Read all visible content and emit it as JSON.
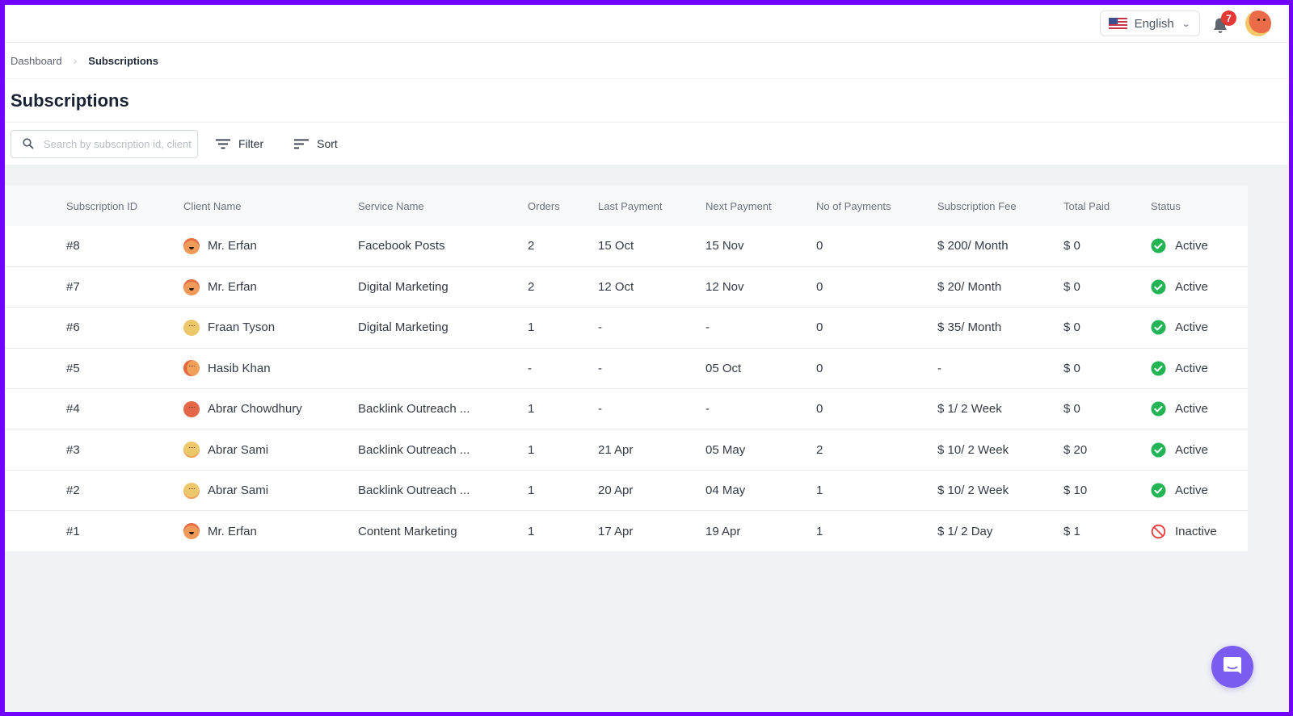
{
  "header": {
    "language": {
      "label": "English",
      "flag_icon": "us-flag-icon"
    },
    "notifications": {
      "count": "7"
    }
  },
  "breadcrumb": {
    "items": [
      {
        "label": "Dashboard"
      },
      {
        "label": "Subscriptions"
      }
    ]
  },
  "page": {
    "title": "Subscriptions"
  },
  "toolbar": {
    "search_placeholder": "Search by subscription id, client",
    "search_value": "",
    "filter_label": "Filter",
    "sort_label": "Sort"
  },
  "table": {
    "columns": [
      "Subscription ID",
      "Client Name",
      "Service Name",
      "Orders",
      "Last Payment",
      "Next Payment",
      "No of Payments",
      "Subscription Fee",
      "Total Paid",
      "Status"
    ],
    "rows": [
      {
        "id": "#8",
        "client": "Mr. Erfan",
        "avatar": "erfan",
        "service": "Facebook Posts",
        "orders": "2",
        "last_payment": "15 Oct",
        "next_payment": "15 Nov",
        "num_payments": "0",
        "fee": "$ 200/ Month",
        "total_paid": "$ 0",
        "status": "Active"
      },
      {
        "id": "#7",
        "client": "Mr. Erfan",
        "avatar": "erfan",
        "service": "Digital Marketing",
        "orders": "2",
        "last_payment": "12 Oct",
        "next_payment": "12 Nov",
        "num_payments": "0",
        "fee": "$ 20/ Month",
        "total_paid": "$ 0",
        "status": "Active"
      },
      {
        "id": "#6",
        "client": "Fraan Tyson",
        "avatar": "fraan",
        "service": "Digital Marketing",
        "orders": "1",
        "last_payment": "-",
        "next_payment": "-",
        "num_payments": "0",
        "fee": "$ 35/ Month",
        "total_paid": "$ 0",
        "status": "Active"
      },
      {
        "id": "#5",
        "client": "Hasib Khan",
        "avatar": "hasib",
        "service": "",
        "orders": "-",
        "last_payment": "-",
        "next_payment": "05 Oct",
        "num_payments": "0",
        "fee": "-",
        "total_paid": "$ 0",
        "status": "Active"
      },
      {
        "id": "#4",
        "client": "Abrar Chowdhury",
        "avatar": "abrarc",
        "service": "Backlink Outreach ...",
        "orders": "1",
        "last_payment": "-",
        "next_payment": "-",
        "num_payments": "0",
        "fee": "$ 1/ 2 Week",
        "total_paid": "$ 0",
        "status": "Active"
      },
      {
        "id": "#3",
        "client": "Abrar Sami",
        "avatar": "abrars",
        "service": "Backlink Outreach ...",
        "orders": "1",
        "last_payment": "21 Apr",
        "next_payment": "05 May",
        "num_payments": "2",
        "fee": "$ 10/ 2 Week",
        "total_paid": "$ 20",
        "status": "Active"
      },
      {
        "id": "#2",
        "client": "Abrar Sami",
        "avatar": "abrars",
        "service": "Backlink Outreach ...",
        "orders": "1",
        "last_payment": "20 Apr",
        "next_payment": "04 May",
        "num_payments": "1",
        "fee": "$ 10/ 2 Week",
        "total_paid": "$ 10",
        "status": "Active"
      },
      {
        "id": "#1",
        "client": "Mr. Erfan",
        "avatar": "erfan",
        "service": "Content Marketing",
        "orders": "1",
        "last_payment": "17 Apr",
        "next_payment": "19 Apr",
        "num_payments": "1",
        "fee": "$ 1/ 2 Day",
        "total_paid": "$ 1",
        "status": "Inactive"
      }
    ]
  },
  "colors": {
    "frame": "#7000ff",
    "active": "#22b455",
    "inactive": "#e5393a",
    "badge": "#e53935",
    "chat_fab": "#7b5cf0"
  }
}
